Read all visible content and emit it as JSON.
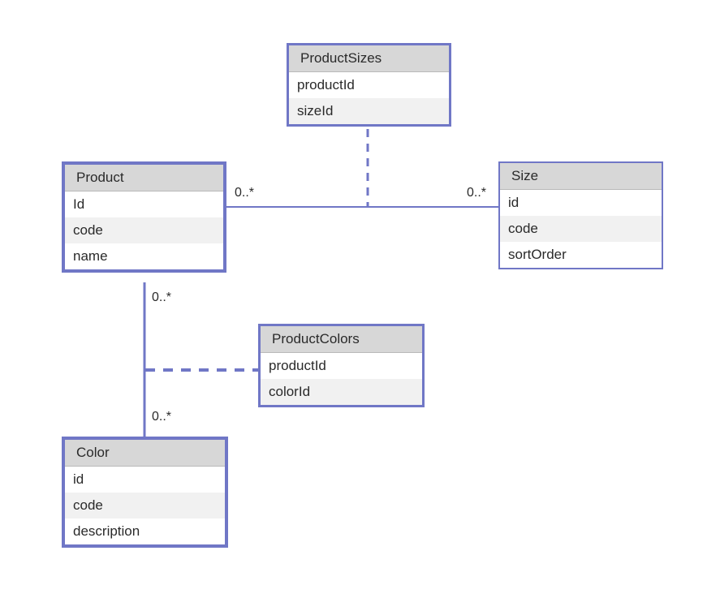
{
  "entities": {
    "productSizes": {
      "title": "ProductSizes",
      "attrs": [
        "productId",
        "sizeId"
      ]
    },
    "product": {
      "title": "Product",
      "attrs": [
        "Id",
        "code",
        "name"
      ]
    },
    "size": {
      "title": "Size",
      "attrs": [
        "id",
        "code",
        "sortOrder"
      ]
    },
    "productColors": {
      "title": "ProductColors",
      "attrs": [
        "productId",
        "colorId"
      ]
    },
    "color": {
      "title": "Color",
      "attrs": [
        "id",
        "code",
        "description"
      ]
    }
  },
  "multiplicities": {
    "productSizeLeft": "0..*",
    "productSizeRight": "0..*",
    "productColorTop": "0..*",
    "productColorBottom": "0..*"
  },
  "chart_data": {
    "type": "uml-class-diagram",
    "classes": [
      {
        "name": "ProductSizes",
        "attributes": [
          "productId",
          "sizeId"
        ]
      },
      {
        "name": "Product",
        "attributes": [
          "Id",
          "code",
          "name"
        ]
      },
      {
        "name": "Size",
        "attributes": [
          "id",
          "code",
          "sortOrder"
        ]
      },
      {
        "name": "ProductColors",
        "attributes": [
          "productId",
          "colorId"
        ]
      },
      {
        "name": "Color",
        "attributes": [
          "id",
          "code",
          "description"
        ]
      }
    ],
    "associations": [
      {
        "from": "Product",
        "to": "Size",
        "fromMultiplicity": "0..*",
        "toMultiplicity": "0..*",
        "associationClass": "ProductSizes"
      },
      {
        "from": "Product",
        "to": "Color",
        "fromMultiplicity": "0..*",
        "toMultiplicity": "0..*",
        "associationClass": "ProductColors"
      }
    ]
  }
}
